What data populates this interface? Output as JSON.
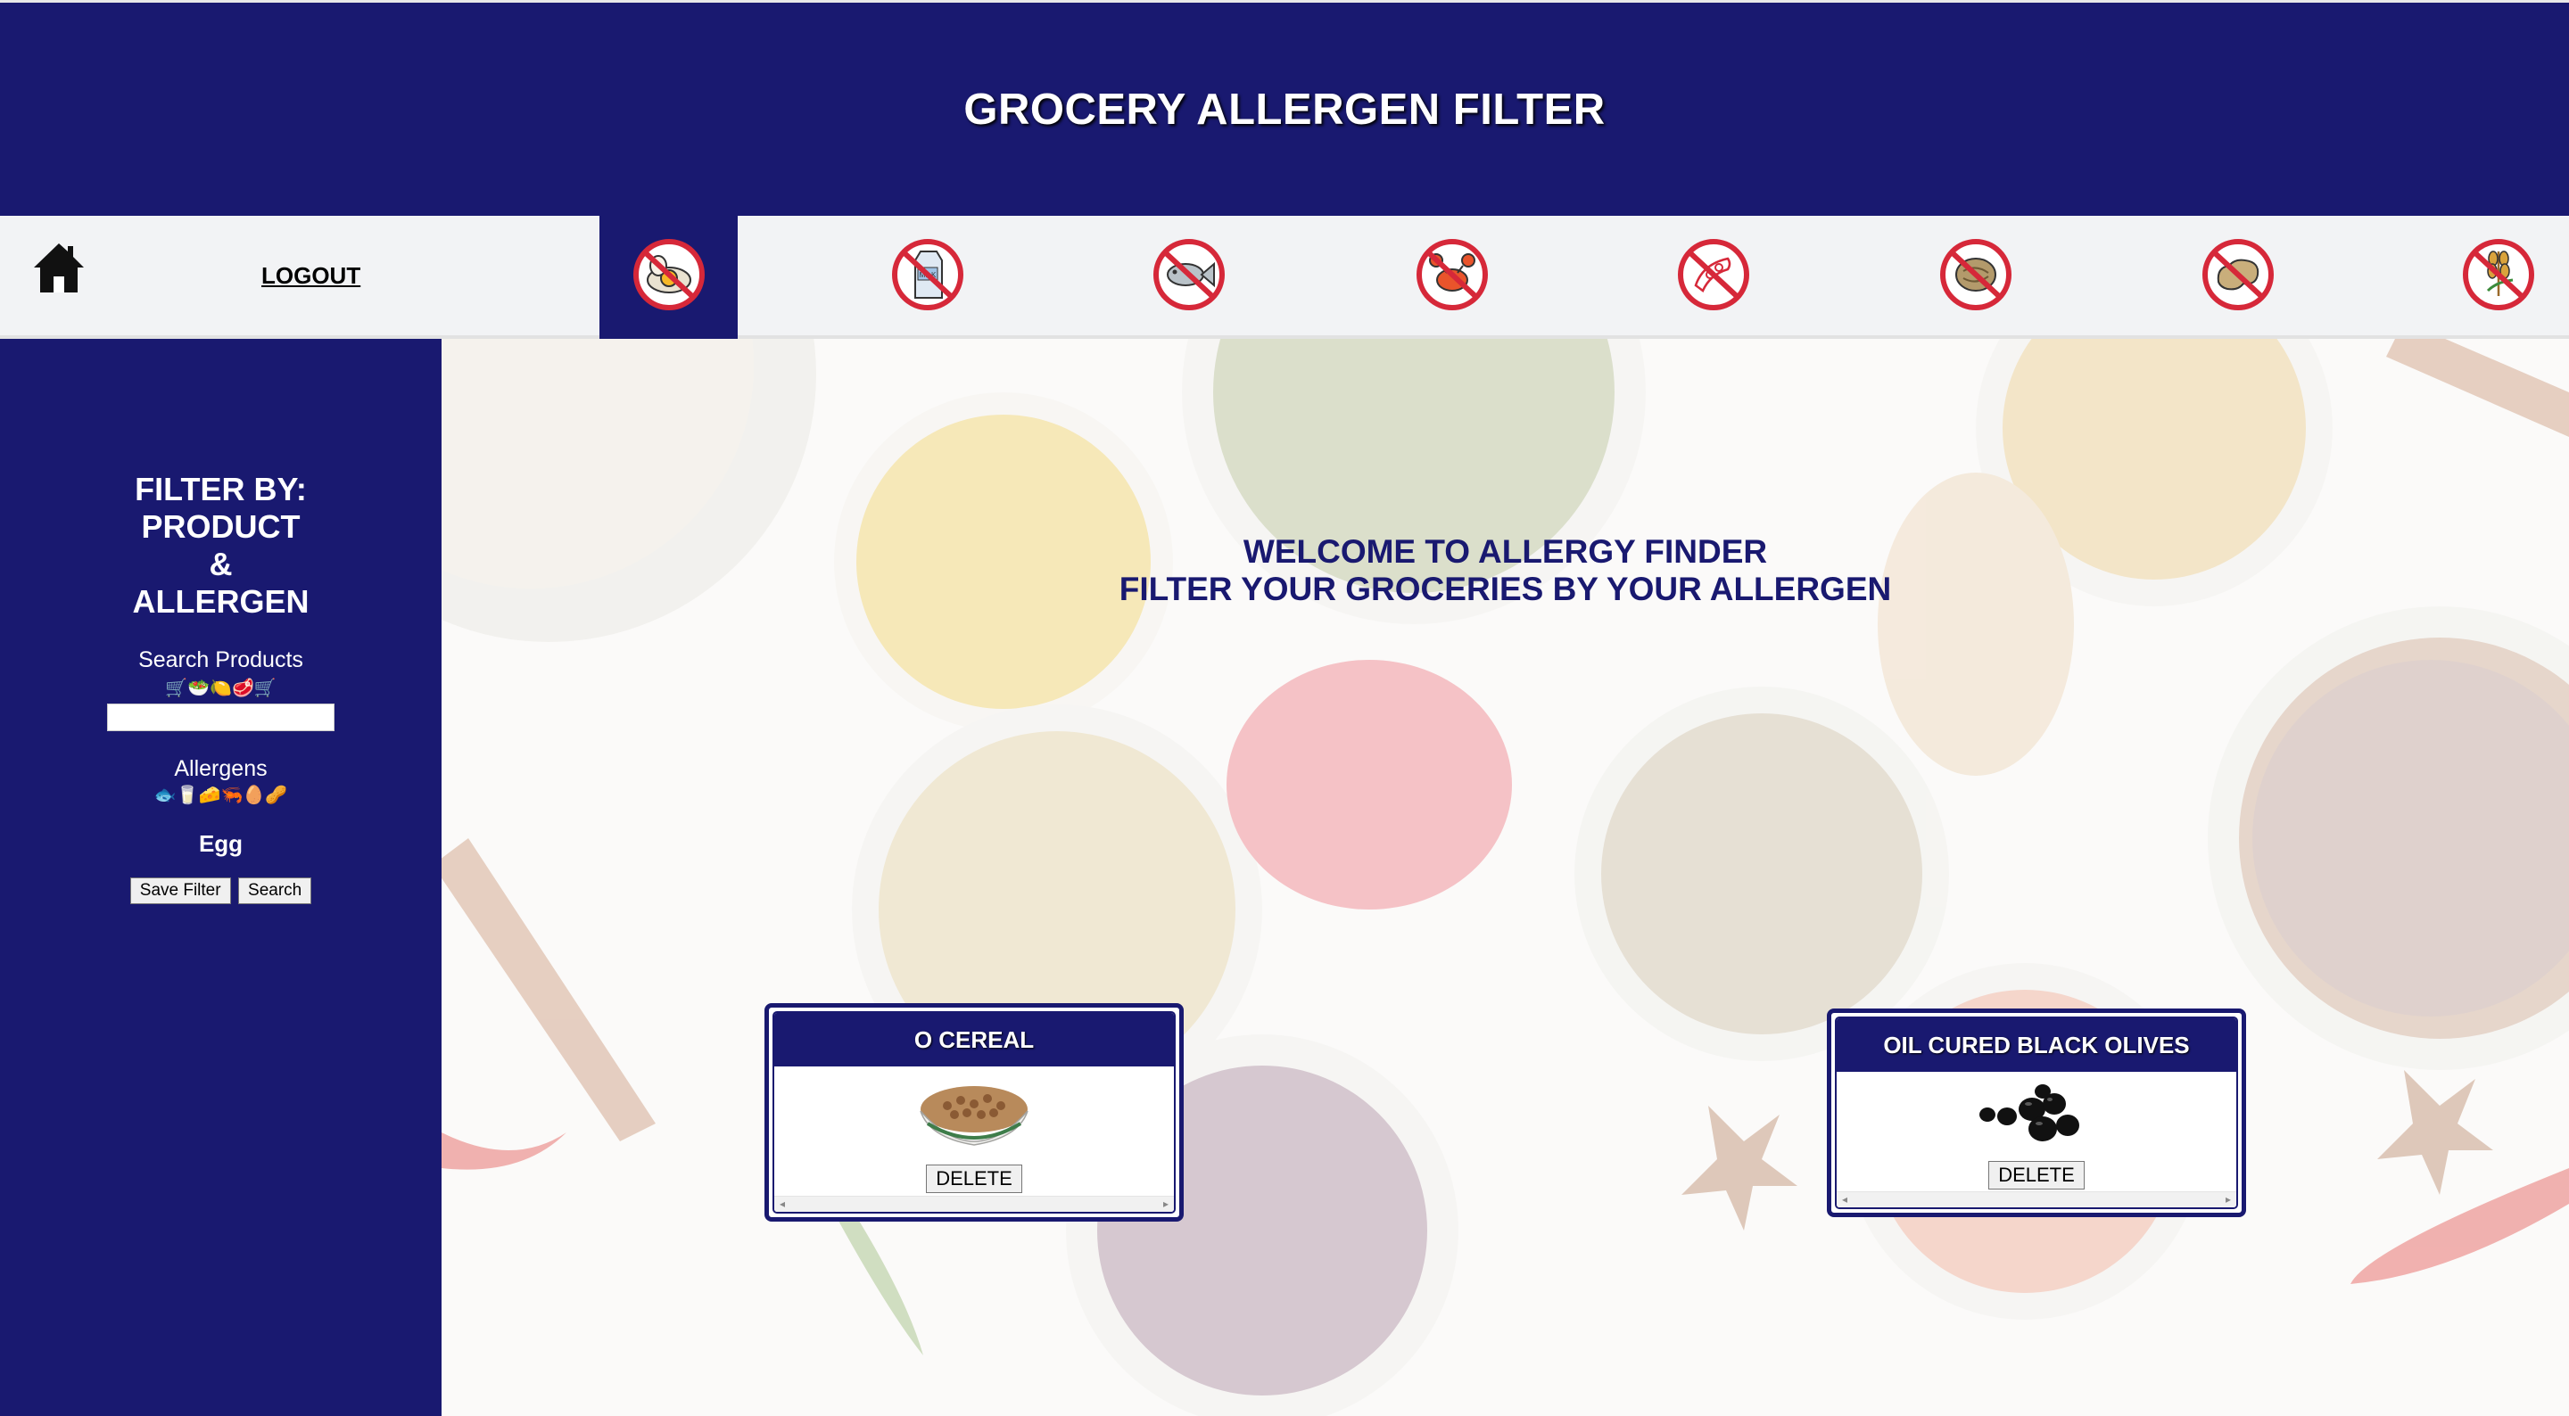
{
  "header": {
    "title": "GROCERY ALLERGEN FILTER"
  },
  "nav": {
    "logout_label": "LOGOUT",
    "allergen_icons": [
      "egg-allergen-icon",
      "milk-allergen-icon",
      "fish-allergen-icon",
      "shellfish-allergen-icon",
      "soy-allergen-icon",
      "tree-nut-allergen-icon",
      "peanut-allergen-icon",
      "wheat-allergen-icon"
    ],
    "active_index": 0
  },
  "sidebar": {
    "filter_title_lines": [
      "FILTER BY:",
      "PRODUCT",
      "&",
      "ALLERGEN"
    ],
    "search_label": "Search Products",
    "search_emojis": "🛒🥗🍋🥩🛒",
    "search_value": "",
    "allergens_label": "Allergens",
    "allergen_emojis": "🐟🥛🧀🦐🥚🥜",
    "selected_allergen": "Egg",
    "save_filter_label": "Save Filter",
    "search_button_label": "Search"
  },
  "main": {
    "welcome_line1": "WELCOME TO ALLERGY FINDER",
    "welcome_line2": "FILTER YOUR GROCERIES BY YOUR ALLERGEN"
  },
  "cards": [
    {
      "title": "O CEREAL",
      "image": "cereal-bowl",
      "delete_label": "DELETE"
    },
    {
      "title": "OIL CURED BLACK OLIVES",
      "image": "black-olives",
      "delete_label": "DELETE"
    }
  ],
  "colors": {
    "navy": "#191970",
    "nav_bg": "#f2f3f5",
    "allergen_red": "#d62839"
  }
}
